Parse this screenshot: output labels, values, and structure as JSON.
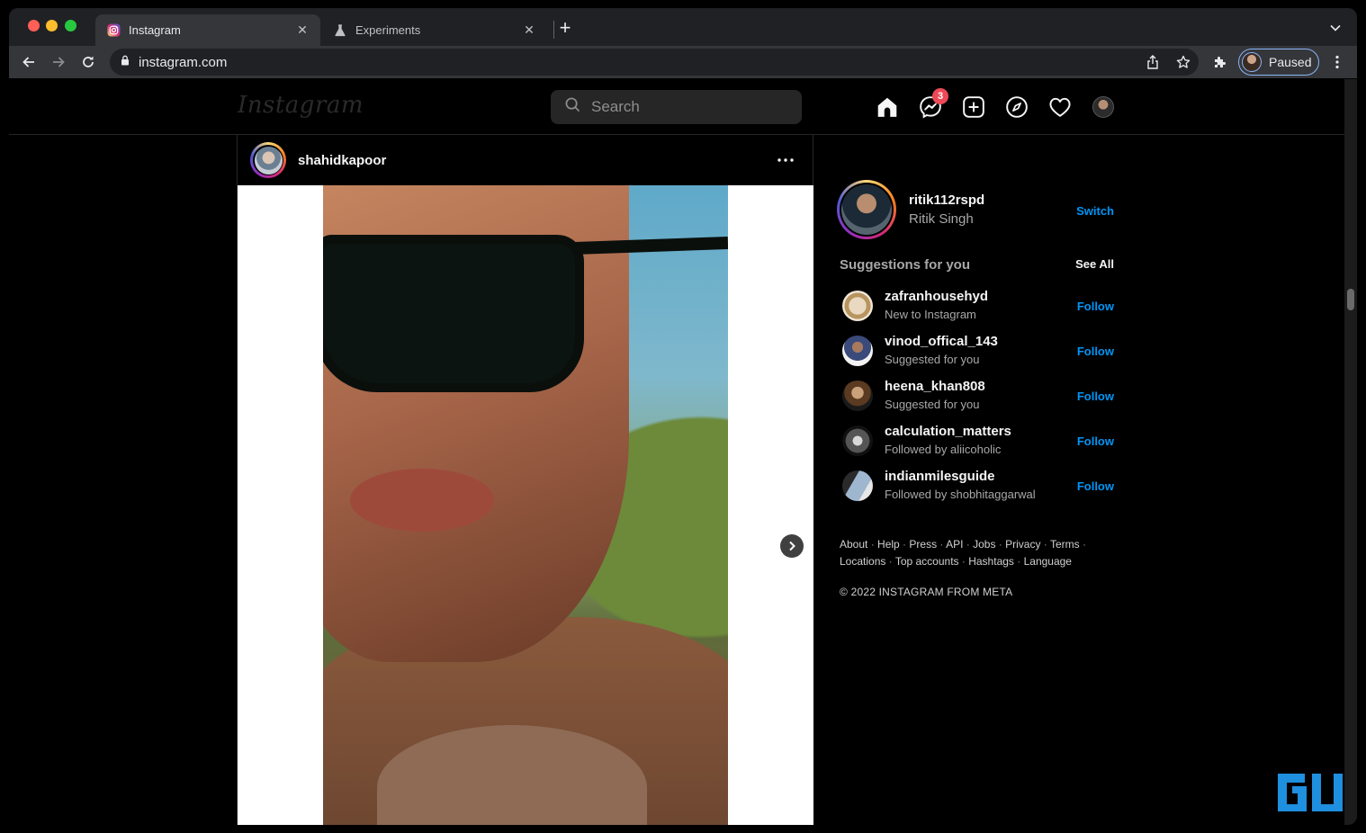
{
  "browser": {
    "tabs": [
      {
        "title": "Instagram",
        "active": true,
        "icon": "instagram-favicon"
      },
      {
        "title": "Experiments",
        "active": false,
        "icon": "flask-icon"
      }
    ],
    "new_tab_label": "+",
    "url": "instagram.com",
    "profile_status": "Paused",
    "colors": {
      "tabstrip": "#202124",
      "toolbar": "#35363a",
      "accent": "#8ab4f8"
    }
  },
  "instagram": {
    "logo": "Instagram",
    "search_placeholder": "Search",
    "messenger_badge": "3",
    "nav_icons": [
      "home-icon",
      "messenger-icon",
      "new-post-icon",
      "explore-icon",
      "activity-heart-icon",
      "profile-avatar"
    ],
    "post": {
      "username": "shahidkapoor"
    },
    "me": {
      "username": "ritik112rspd",
      "full_name": "Ritik Singh",
      "switch_label": "Switch"
    },
    "suggestions_title": "Suggestions for you",
    "see_all_label": "See All",
    "suggestions": [
      {
        "username": "zafranhousehyd",
        "subtitle": "New to Instagram",
        "action": "Follow"
      },
      {
        "username": "vinod_offical_143",
        "subtitle": "Suggested for you",
        "action": "Follow"
      },
      {
        "username": "heena_khan808",
        "subtitle": "Suggested for you",
        "action": "Follow"
      },
      {
        "username": "calculation_matters",
        "subtitle": "Followed by aliicoholic",
        "action": "Follow"
      },
      {
        "username": "indianmilesguide",
        "subtitle": "Followed by shobhitaggarwal",
        "action": "Follow"
      }
    ],
    "footer_links": [
      "About",
      "Help",
      "Press",
      "API",
      "Jobs",
      "Privacy",
      "Terms",
      "Locations",
      "Top accounts",
      "Hashtags",
      "Language"
    ],
    "copyright": "© 2022 INSTAGRAM FROM META",
    "colors": {
      "link_blue": "#0095f6",
      "badge_red": "#ed4956",
      "muted": "#a8a8a8"
    }
  }
}
